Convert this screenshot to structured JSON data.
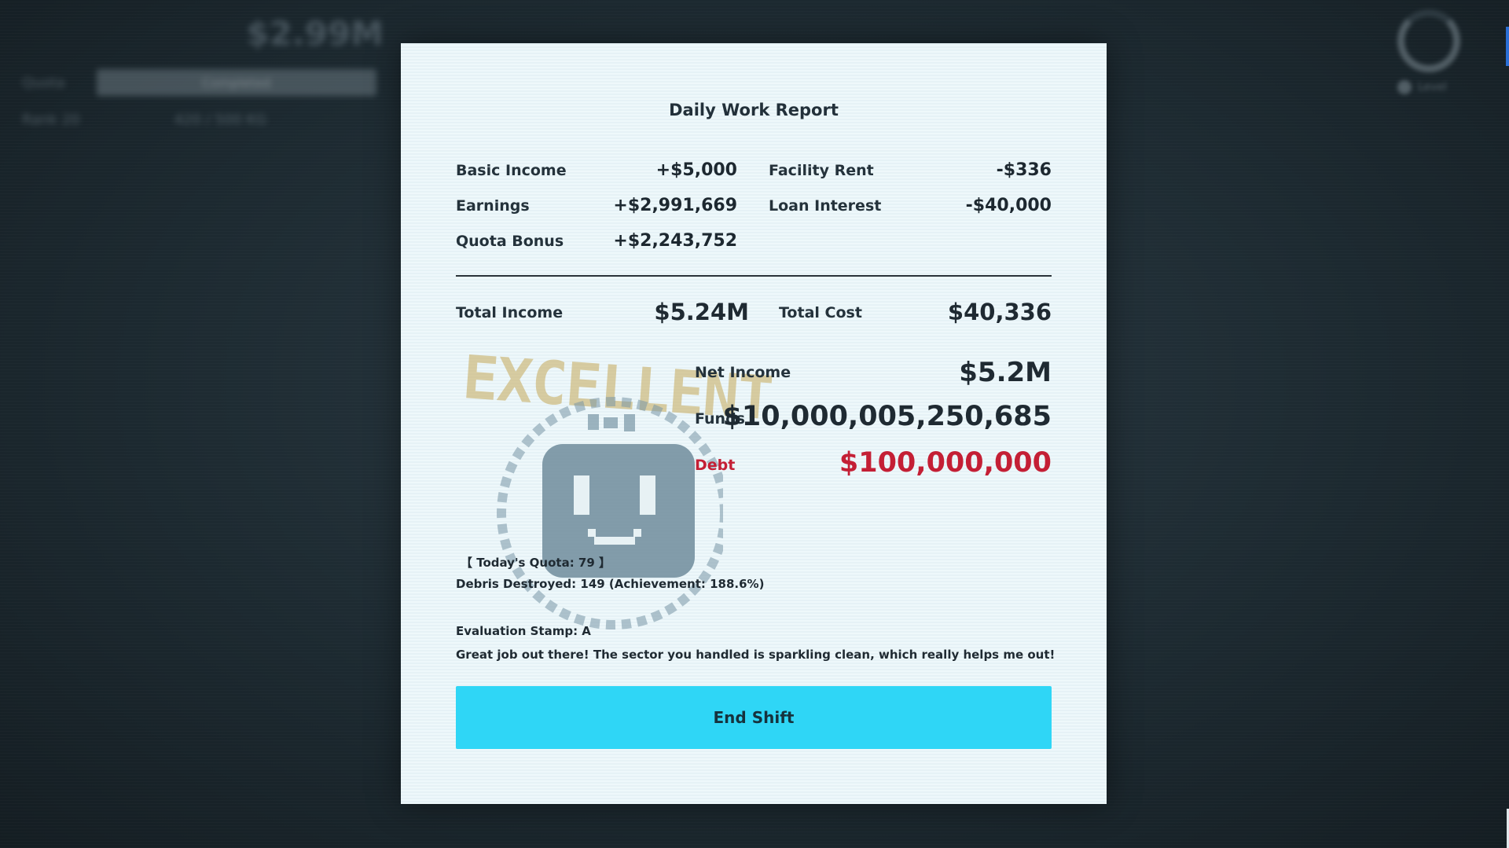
{
  "hud": {
    "money": "$2.99M",
    "quota_label": "Quota",
    "quota_bar": "Completed",
    "row2_left": "Rank 20",
    "row2_right": "420 / 500 KG",
    "clock_sub": "Level"
  },
  "report": {
    "title": "Daily Work Report",
    "income_items": [
      {
        "label": "Basic Income",
        "value": "+$5,000"
      },
      {
        "label": "Earnings",
        "value": "+$2,991,669"
      },
      {
        "label": "Quota Bonus",
        "value": "+$2,243,752"
      }
    ],
    "cost_items": [
      {
        "label": "Facility Rent",
        "value": "-$336"
      },
      {
        "label": "Loan Interest",
        "value": "-$40,000"
      }
    ],
    "total_income_label": "Total Income",
    "total_income_value": "$5.24M",
    "total_cost_label": "Total Cost",
    "total_cost_value": "$40,336",
    "net_income_label": "Net Income",
    "net_income_value": "$5.2M",
    "funds_label": "Funds",
    "funds_value": "$10,000,005,250,685",
    "debt_label": "Debt",
    "debt_value": "$100,000,000",
    "stamp_text": "EXCELLENT",
    "quota_line": "【 Today's Quota: 79 】",
    "debris_line": "Debris Destroyed: 149 (Achievement: 188.6%)",
    "evaluation_line": "Evaluation Stamp: A",
    "comment_line": "Great job out there! The sector you handled is sparkling clean, which really helps me out!",
    "end_button": "End Shift"
  },
  "colors": {
    "accent_button": "#2fd6f6",
    "debt_red": "#c41f35",
    "stamp_gold": "#c4a858",
    "card_bg": "#eaf5f8"
  }
}
